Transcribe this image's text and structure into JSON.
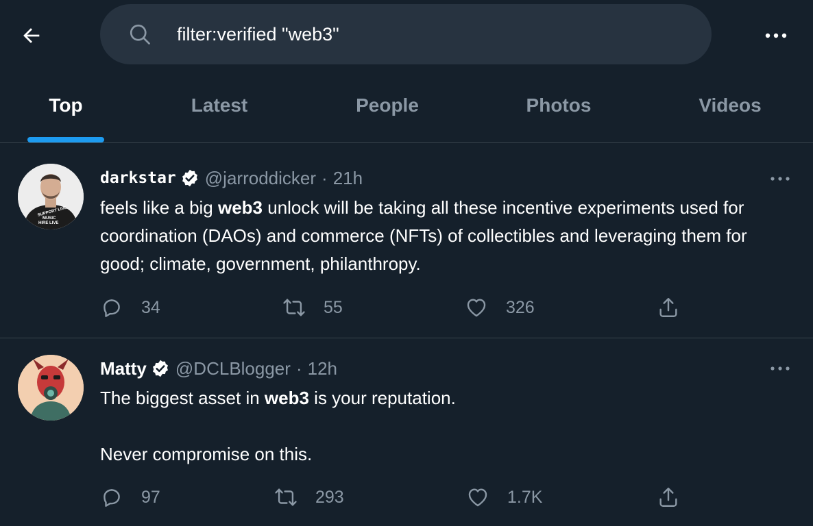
{
  "search": {
    "value": "filter:verified \"web3\""
  },
  "tabs": [
    {
      "label": "Top",
      "active": true
    },
    {
      "label": "Latest",
      "active": false
    },
    {
      "label": "People",
      "active": false
    },
    {
      "label": "Photos",
      "active": false
    },
    {
      "label": "Videos",
      "active": false
    }
  ],
  "tweets": [
    {
      "display_name": "darkstar",
      "handle": "@jarroddicker",
      "separator": "·",
      "time": "21h",
      "text_before": "feels like a big ",
      "text_bold": "web3",
      "text_after": " unlock will be taking all these incentive experiments used for coordination (DAOs) and commerce (NFTs) of collectibles and leveraging them for good; climate, government, philanthropy.",
      "avatar_text": "SUPPORT LIVE MUSIC HIRE LIVE",
      "replies": "34",
      "retweets": "55",
      "likes": "326"
    },
    {
      "display_name": "Matty",
      "handle": "@DCLBlogger",
      "separator": "·",
      "time": "12h",
      "text_before": "The biggest asset in ",
      "text_bold": "web3",
      "text_after": " is your reputation.\n\nNever compromise on this.",
      "replies": "97",
      "retweets": "293",
      "likes": "1.7K"
    }
  ],
  "colors": {
    "background": "#15202b",
    "search_bg": "#273340",
    "accent": "#1d9bf0",
    "muted": "#8b98a5",
    "divider": "#38444d"
  },
  "icons": [
    "back-arrow-icon",
    "search-icon",
    "more-icon",
    "verified-icon",
    "reply-icon",
    "retweet-icon",
    "like-icon",
    "share-icon"
  ]
}
